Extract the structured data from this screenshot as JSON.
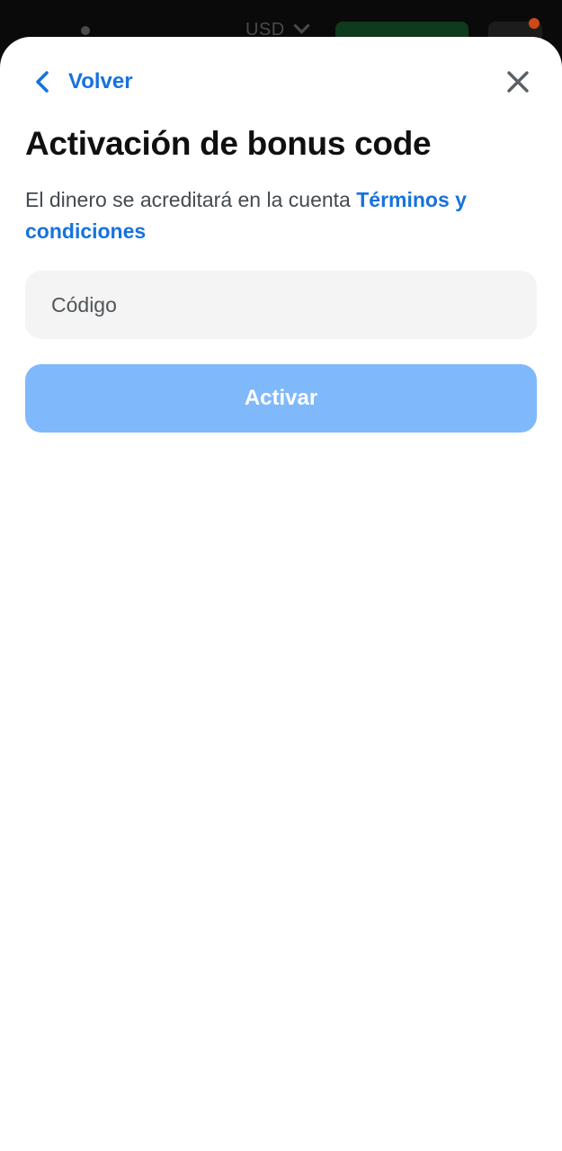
{
  "background": {
    "currency_label": "USD"
  },
  "header": {
    "back_label": "Volver",
    "back_icon": "chevron-left-icon",
    "close_icon": "close-icon"
  },
  "main": {
    "title": "Activación de bonus code",
    "description": "El dinero se acreditará en la cuenta ",
    "terms_link": "Términos y condiciones"
  },
  "form": {
    "code_placeholder": "Código",
    "code_value": "",
    "activate_label": "Activar"
  },
  "colors": {
    "accent": "#1672de",
    "button_disabled": "#7fb9fb",
    "input_bg": "#f4f4f4",
    "title": "#101010",
    "text": "#444a50"
  }
}
